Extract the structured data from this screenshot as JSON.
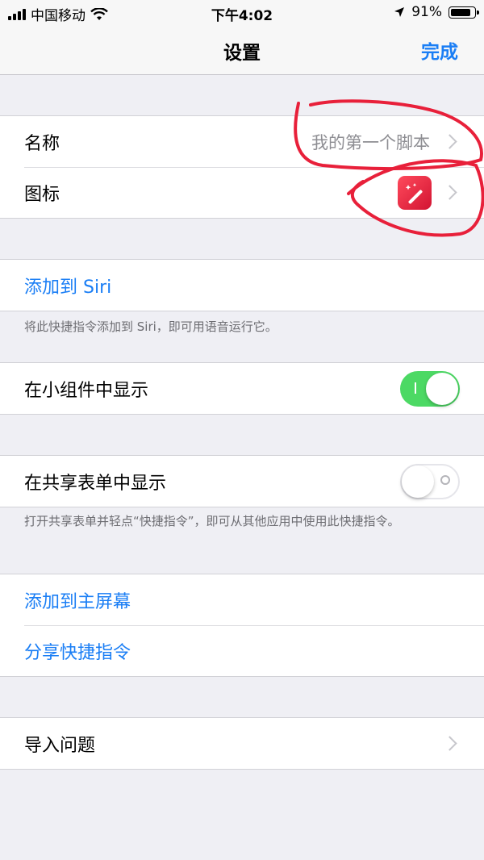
{
  "status_bar": {
    "carrier": "中国移动",
    "time": "下午4:02",
    "battery": "91%",
    "battery_level": 0.91
  },
  "nav": {
    "title": "设置",
    "done_label": "完成"
  },
  "group1": {
    "name_label": "名称",
    "name_value": "我的第一个脚本",
    "icon_label": "图标"
  },
  "siri": {
    "add_label": "添加到 Siri",
    "footer": "将此快捷指令添加到 Siri，即可用语音运行它。"
  },
  "widget": {
    "label": "在小组件中显示",
    "on": true
  },
  "share_sheet": {
    "label": "在共享表单中显示",
    "on": false,
    "footer": "打开共享表单并轻点“快捷指令”，即可从其他应用中使用此快捷指令。"
  },
  "actions": {
    "home_screen": "添加到主屏幕",
    "share": "分享快捷指令"
  },
  "import": {
    "label": "导入问题"
  },
  "colors": {
    "accent": "#1a7ef5",
    "toggle_on": "#4cd964",
    "icon_red": "#e8243d",
    "annotation_red": "#e8203a"
  }
}
